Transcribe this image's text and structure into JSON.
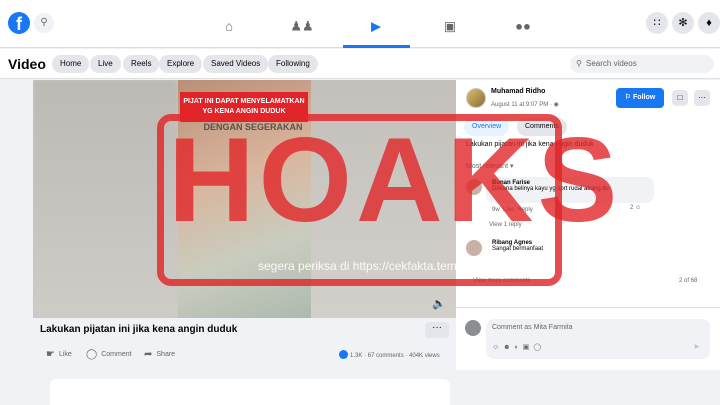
{
  "topbar": {
    "logo": "f",
    "nav": [
      "home-icon",
      "friends-icon",
      "video-icon",
      "marketplace-icon",
      "gaming-icon"
    ],
    "right_icons": [
      "menu-grid-icon",
      "messenger-icon",
      "notifications-icon"
    ]
  },
  "subnav": {
    "title": "Video",
    "tabs": [
      "Home",
      "Live",
      "Reels",
      "Explore",
      "Saved Videos",
      "Following"
    ],
    "search_placeholder": "Search videos"
  },
  "video": {
    "caption_top": "PIJAT INI DAPAT MENYELAMATKAN YG KENA ANGIN DUDUK",
    "caption_bottom": "DENGAN SEGERAKAN",
    "title": "Lakukan pijatan ini jika kena angin duduk",
    "actions": [
      "Like",
      "Comment",
      "Share"
    ],
    "reactions": "1.3K",
    "comments": "67 comments",
    "views": "404K views"
  },
  "post": {
    "author": "Muhamad Ridho",
    "date": "August 11 at 9:07 PM",
    "follow_label": "Follow",
    "tabs": [
      "Overview",
      "Comments"
    ],
    "caption": "Lakukan pijatan ini jika kena angin duduk",
    "sort": "Most relevant",
    "comments": [
      {
        "name": "Bunan Farise",
        "text": "Dimana belinya kayu yg sprt rudal abang itu",
        "meta_time": "9w",
        "meta_like": "Like",
        "meta_reply": "Reply",
        "reactions": "2"
      },
      {
        "name": "Ribang Agnes",
        "text": "Sangat bermanfaat"
      }
    ],
    "view_reply": "View 1 reply",
    "view_more": "View more comments",
    "count": "2 of 68",
    "comment_placeholder": "Comment as Mita Farmita"
  },
  "watermark": {
    "word": "HOAKS",
    "subtitle": "segera periksa di https://cekfakta.tempo.co",
    "color": "#e12628"
  }
}
